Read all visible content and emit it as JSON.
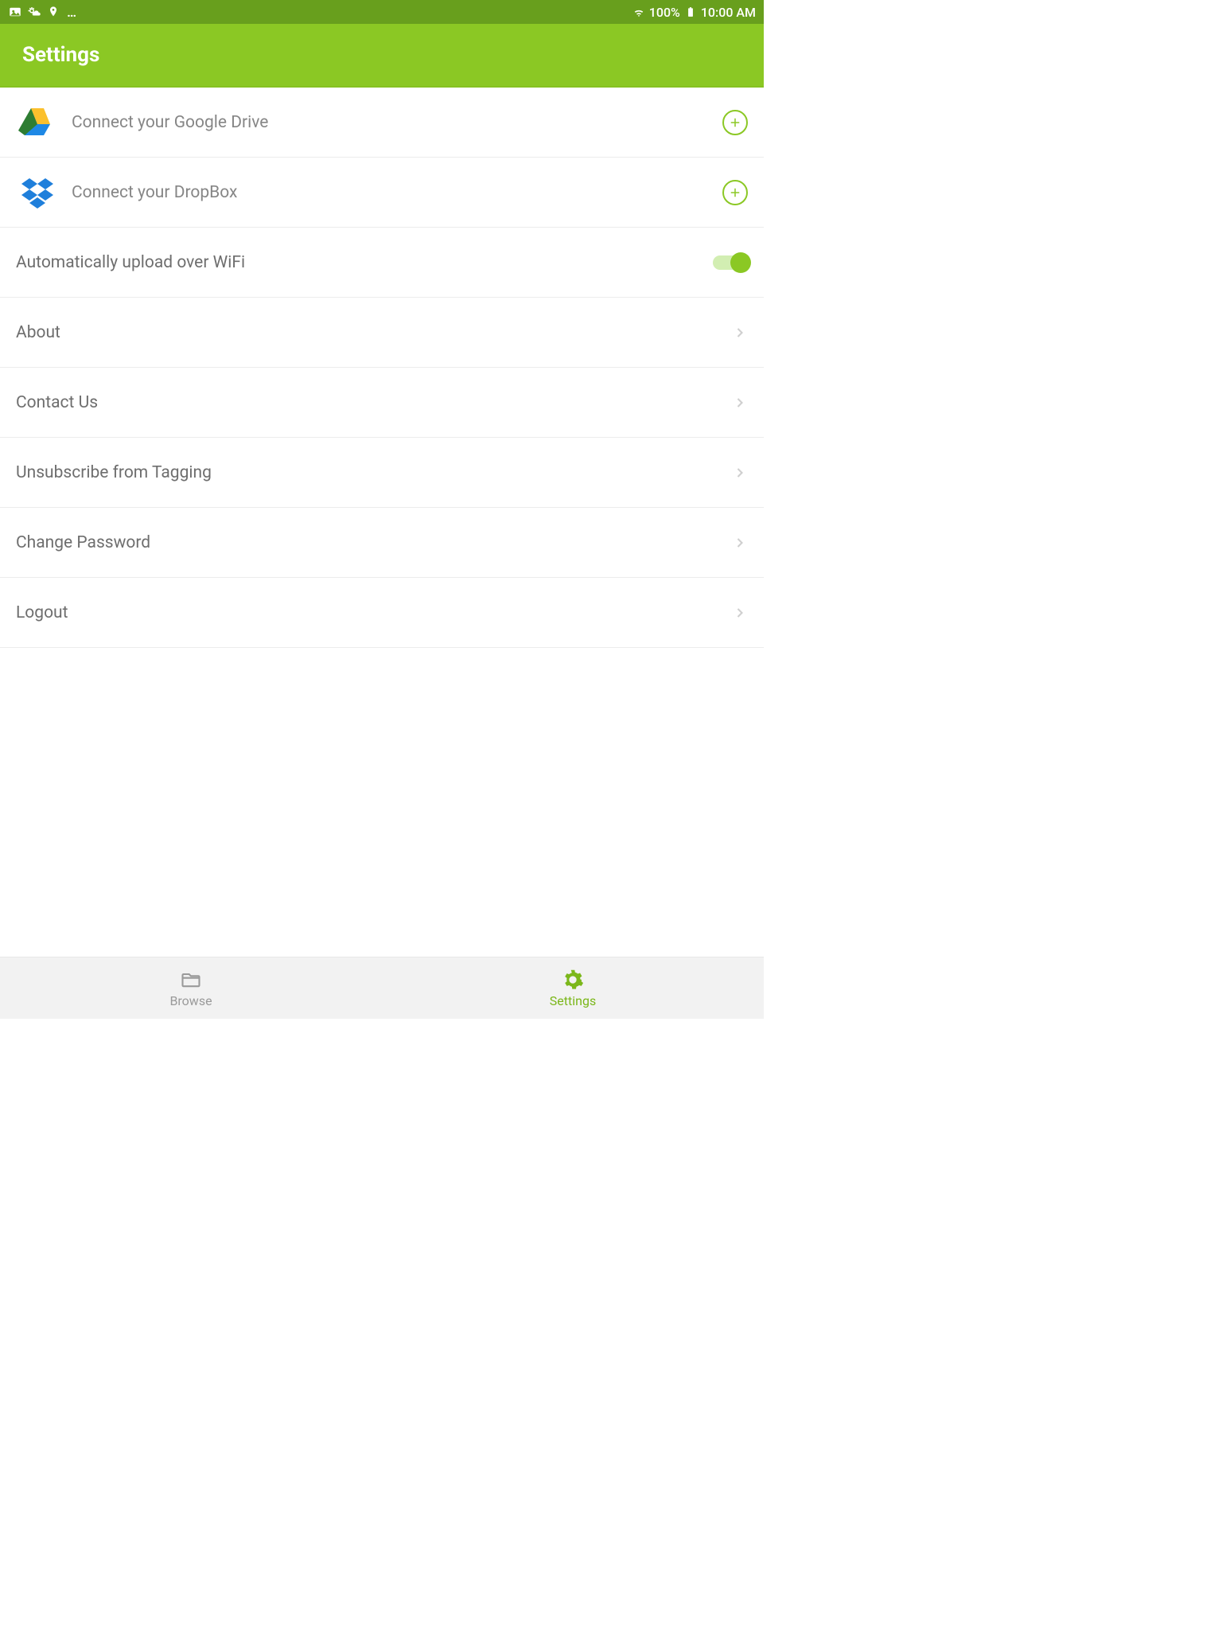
{
  "status": {
    "battery_text": "100%",
    "time": "10:00 AM",
    "icons": {
      "photo": "photo-icon",
      "weather": "sun-cloud-icon",
      "location": "location-pin-icon",
      "more": "…",
      "wifi": "wifi-icon",
      "battery": "battery-full-icon"
    }
  },
  "app_bar": {
    "title": "Settings"
  },
  "rows": {
    "gdrive": {
      "label": "Connect your Google Drive",
      "action_icon": "plus-circle-icon"
    },
    "dropbox": {
      "label": "Connect your DropBox",
      "action_icon": "plus-circle-icon"
    },
    "wifi_upload": {
      "label": "Automatically upload over WiFi",
      "toggle_on": true
    },
    "about": {
      "label": "About"
    },
    "contact": {
      "label": "Contact Us"
    },
    "unsubscribe": {
      "label": "Unsubscribe from Tagging"
    },
    "change_pw": {
      "label": "Change Password"
    },
    "logout": {
      "label": "Logout"
    }
  },
  "bottom_nav": {
    "browse": {
      "label": "Browse",
      "active": false
    },
    "settings": {
      "label": "Settings",
      "active": true
    }
  },
  "colors": {
    "accent": "#8bc824",
    "status_bar": "#689f1d",
    "text_muted": "#868686"
  }
}
